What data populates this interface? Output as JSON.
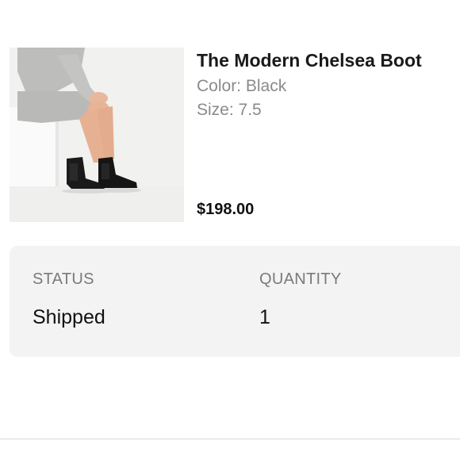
{
  "product": {
    "image_alt": "product-photo-chelsea-boot",
    "title": "The Modern Chelsea Boot",
    "color": "Color: Black",
    "size": "Size: 7.5",
    "price": "$198.00"
  },
  "order_status": {
    "status_label": "STATUS",
    "status_value": "Shipped",
    "quantity_label": "QUANTITY",
    "quantity_value": "1"
  },
  "colors": {
    "card_bg": "#f3f3f3",
    "photo_bg": "#f0f0ef",
    "muted_text": "#8a8a8a"
  }
}
